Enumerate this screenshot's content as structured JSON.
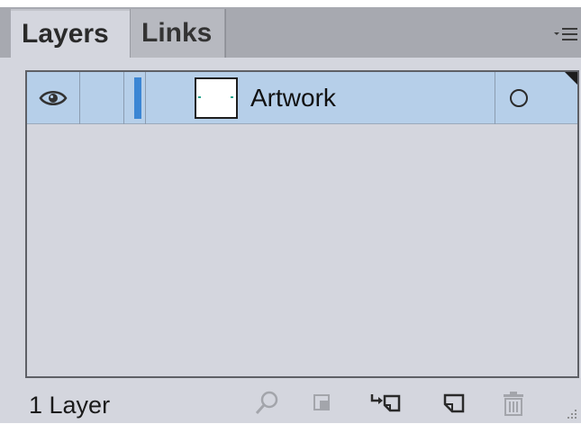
{
  "tabs": [
    {
      "label": "Layers",
      "active": true
    },
    {
      "label": "Links",
      "active": false
    }
  ],
  "layers": [
    {
      "name": "Artwork",
      "visible": true,
      "selected": true,
      "color": "#3b86d4"
    }
  ],
  "footer": {
    "count_label": "1 Layer",
    "icons": [
      "locate-object-icon",
      "make-clipping-mask-icon",
      "create-sublayer-icon",
      "create-new-layer-icon",
      "delete-layer-icon"
    ]
  },
  "colors": {
    "panel_bg": "#d4d6de",
    "tabbar_bg": "#a7a9b0",
    "selection": "#b6cfe9",
    "layer_color": "#3b86d4"
  }
}
